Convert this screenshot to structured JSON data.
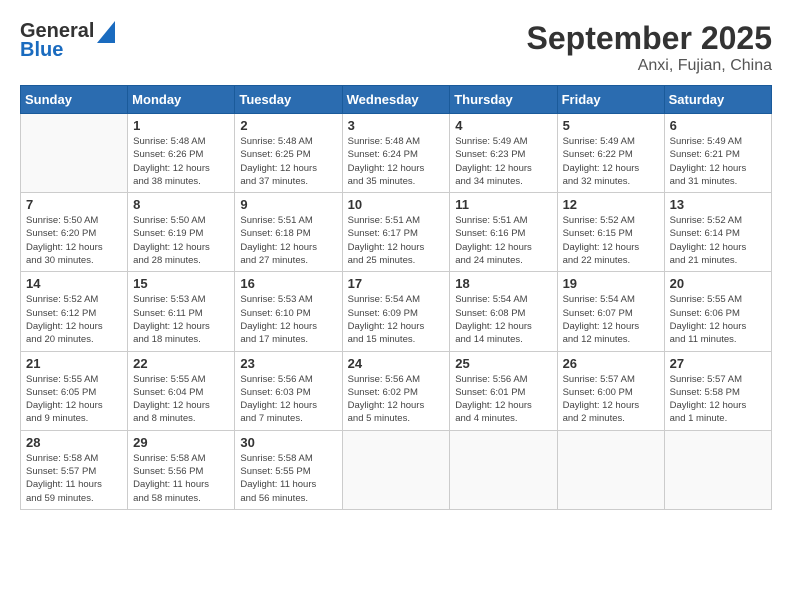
{
  "header": {
    "logo_line1": "General",
    "logo_line2": "Blue",
    "title": "September 2025",
    "subtitle": "Anxi, Fujian, China"
  },
  "calendar": {
    "weekdays": [
      "Sunday",
      "Monday",
      "Tuesday",
      "Wednesday",
      "Thursday",
      "Friday",
      "Saturday"
    ],
    "weeks": [
      [
        {
          "day": "",
          "info": ""
        },
        {
          "day": "1",
          "info": "Sunrise: 5:48 AM\nSunset: 6:26 PM\nDaylight: 12 hours\nand 38 minutes."
        },
        {
          "day": "2",
          "info": "Sunrise: 5:48 AM\nSunset: 6:25 PM\nDaylight: 12 hours\nand 37 minutes."
        },
        {
          "day": "3",
          "info": "Sunrise: 5:48 AM\nSunset: 6:24 PM\nDaylight: 12 hours\nand 35 minutes."
        },
        {
          "day": "4",
          "info": "Sunrise: 5:49 AM\nSunset: 6:23 PM\nDaylight: 12 hours\nand 34 minutes."
        },
        {
          "day": "5",
          "info": "Sunrise: 5:49 AM\nSunset: 6:22 PM\nDaylight: 12 hours\nand 32 minutes."
        },
        {
          "day": "6",
          "info": "Sunrise: 5:49 AM\nSunset: 6:21 PM\nDaylight: 12 hours\nand 31 minutes."
        }
      ],
      [
        {
          "day": "7",
          "info": "Sunrise: 5:50 AM\nSunset: 6:20 PM\nDaylight: 12 hours\nand 30 minutes."
        },
        {
          "day": "8",
          "info": "Sunrise: 5:50 AM\nSunset: 6:19 PM\nDaylight: 12 hours\nand 28 minutes."
        },
        {
          "day": "9",
          "info": "Sunrise: 5:51 AM\nSunset: 6:18 PM\nDaylight: 12 hours\nand 27 minutes."
        },
        {
          "day": "10",
          "info": "Sunrise: 5:51 AM\nSunset: 6:17 PM\nDaylight: 12 hours\nand 25 minutes."
        },
        {
          "day": "11",
          "info": "Sunrise: 5:51 AM\nSunset: 6:16 PM\nDaylight: 12 hours\nand 24 minutes."
        },
        {
          "day": "12",
          "info": "Sunrise: 5:52 AM\nSunset: 6:15 PM\nDaylight: 12 hours\nand 22 minutes."
        },
        {
          "day": "13",
          "info": "Sunrise: 5:52 AM\nSunset: 6:14 PM\nDaylight: 12 hours\nand 21 minutes."
        }
      ],
      [
        {
          "day": "14",
          "info": "Sunrise: 5:52 AM\nSunset: 6:12 PM\nDaylight: 12 hours\nand 20 minutes."
        },
        {
          "day": "15",
          "info": "Sunrise: 5:53 AM\nSunset: 6:11 PM\nDaylight: 12 hours\nand 18 minutes."
        },
        {
          "day": "16",
          "info": "Sunrise: 5:53 AM\nSunset: 6:10 PM\nDaylight: 12 hours\nand 17 minutes."
        },
        {
          "day": "17",
          "info": "Sunrise: 5:54 AM\nSunset: 6:09 PM\nDaylight: 12 hours\nand 15 minutes."
        },
        {
          "day": "18",
          "info": "Sunrise: 5:54 AM\nSunset: 6:08 PM\nDaylight: 12 hours\nand 14 minutes."
        },
        {
          "day": "19",
          "info": "Sunrise: 5:54 AM\nSunset: 6:07 PM\nDaylight: 12 hours\nand 12 minutes."
        },
        {
          "day": "20",
          "info": "Sunrise: 5:55 AM\nSunset: 6:06 PM\nDaylight: 12 hours\nand 11 minutes."
        }
      ],
      [
        {
          "day": "21",
          "info": "Sunrise: 5:55 AM\nSunset: 6:05 PM\nDaylight: 12 hours\nand 9 minutes."
        },
        {
          "day": "22",
          "info": "Sunrise: 5:55 AM\nSunset: 6:04 PM\nDaylight: 12 hours\nand 8 minutes."
        },
        {
          "day": "23",
          "info": "Sunrise: 5:56 AM\nSunset: 6:03 PM\nDaylight: 12 hours\nand 7 minutes."
        },
        {
          "day": "24",
          "info": "Sunrise: 5:56 AM\nSunset: 6:02 PM\nDaylight: 12 hours\nand 5 minutes."
        },
        {
          "day": "25",
          "info": "Sunrise: 5:56 AM\nSunset: 6:01 PM\nDaylight: 12 hours\nand 4 minutes."
        },
        {
          "day": "26",
          "info": "Sunrise: 5:57 AM\nSunset: 6:00 PM\nDaylight: 12 hours\nand 2 minutes."
        },
        {
          "day": "27",
          "info": "Sunrise: 5:57 AM\nSunset: 5:58 PM\nDaylight: 12 hours\nand 1 minute."
        }
      ],
      [
        {
          "day": "28",
          "info": "Sunrise: 5:58 AM\nSunset: 5:57 PM\nDaylight: 11 hours\nand 59 minutes."
        },
        {
          "day": "29",
          "info": "Sunrise: 5:58 AM\nSunset: 5:56 PM\nDaylight: 11 hours\nand 58 minutes."
        },
        {
          "day": "30",
          "info": "Sunrise: 5:58 AM\nSunset: 5:55 PM\nDaylight: 11 hours\nand 56 minutes."
        },
        {
          "day": "",
          "info": ""
        },
        {
          "day": "",
          "info": ""
        },
        {
          "day": "",
          "info": ""
        },
        {
          "day": "",
          "info": ""
        }
      ]
    ]
  }
}
